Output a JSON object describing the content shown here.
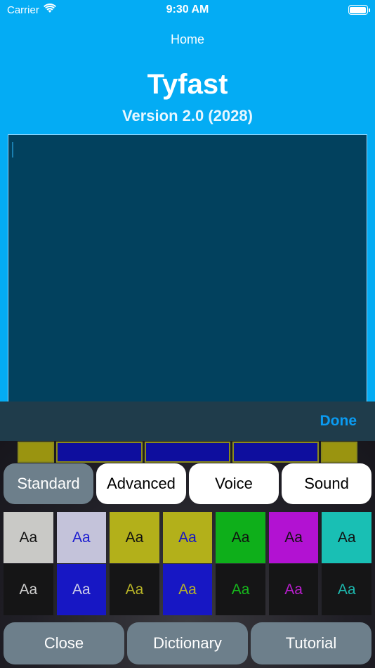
{
  "status_bar": {
    "carrier": "Carrier",
    "time": "9:30 AM",
    "wifi_icon": "wifi-icon",
    "battery_icon": "battery-icon"
  },
  "nav": {
    "title": "Home"
  },
  "app": {
    "title": "Tyfast",
    "version": "Version 2.0 (2028)"
  },
  "accessory": {
    "done_label": "Done"
  },
  "keyboard": {
    "tabs": [
      {
        "label": "Standard",
        "active": true
      },
      {
        "label": "Advanced",
        "active": false
      },
      {
        "label": "Voice",
        "active": false
      },
      {
        "label": "Sound",
        "active": false
      }
    ],
    "swatch_label": "Aa",
    "swatches_top": [
      {
        "bg": "#C9C9C6",
        "fg": "#111111"
      },
      {
        "bg": "#C4C3DA",
        "fg": "#1B1BD0"
      },
      {
        "bg": "#B3B01A",
        "fg": "#111111"
      },
      {
        "bg": "#B3B01A",
        "fg": "#1414C8"
      },
      {
        "bg": "#0EAF1A",
        "fg": "#111111"
      },
      {
        "bg": "#B212D2",
        "fg": "#111111"
      },
      {
        "bg": "#19BFB4",
        "fg": "#111111"
      }
    ],
    "swatches_bottom": [
      {
        "bg": "#151516",
        "fg": "#CFCFCF"
      },
      {
        "bg": "#1717C4",
        "fg": "#CFCFE8"
      },
      {
        "bg": "#151516",
        "fg": "#B8B427"
      },
      {
        "bg": "#1717C4",
        "fg": "#B8B427"
      },
      {
        "bg": "#151516",
        "fg": "#16B81C"
      },
      {
        "bg": "#151516",
        "fg": "#BA1ECF"
      },
      {
        "bg": "#151516",
        "fg": "#1DB8AE"
      }
    ],
    "bottom_buttons": [
      {
        "label": "Close"
      },
      {
        "label": "Dictionary"
      },
      {
        "label": "Tutorial"
      }
    ]
  },
  "colors": {
    "background": "#04ACF4",
    "text_area": "#02415E",
    "accent": "#0A9BF2",
    "tab_active": "#6D7F8B"
  }
}
